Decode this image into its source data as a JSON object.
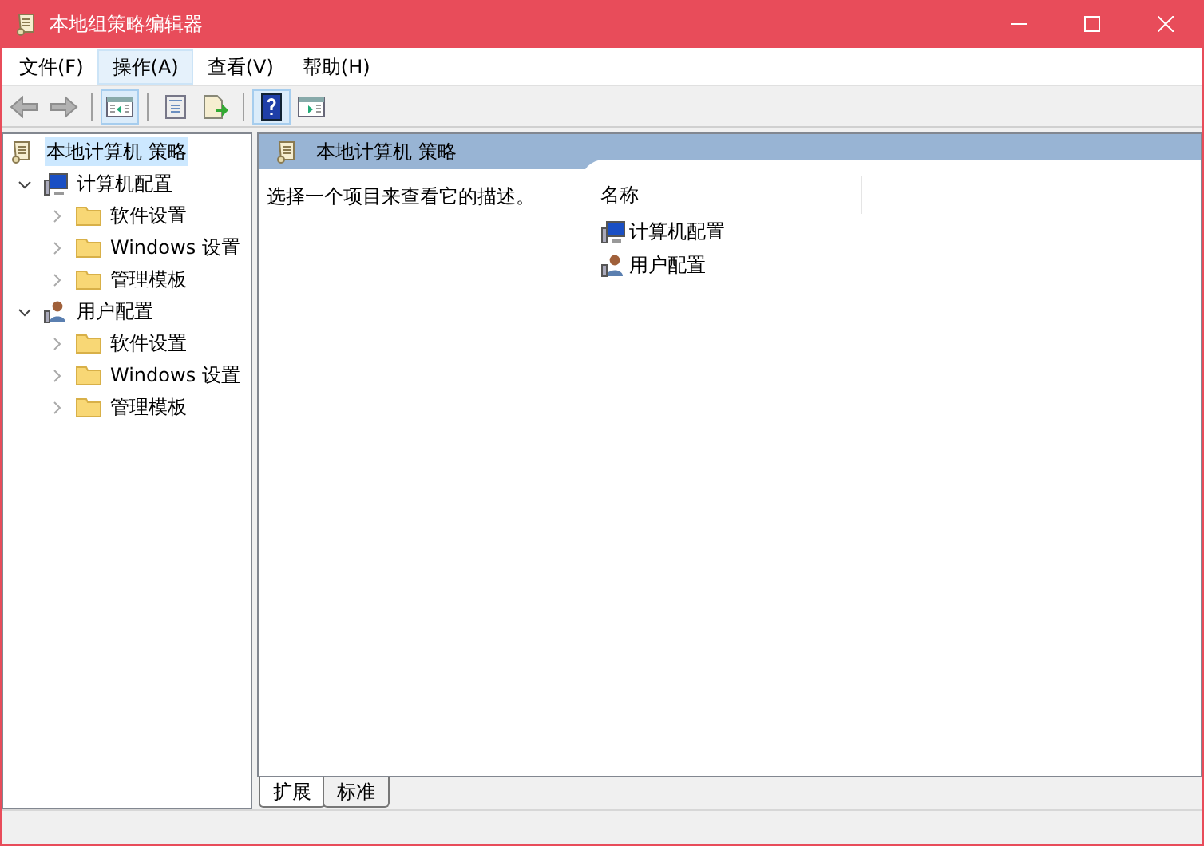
{
  "window": {
    "title": "本地组策略编辑器"
  },
  "menu": [
    {
      "label": "文件(F)",
      "selected": false
    },
    {
      "label": "操作(A)",
      "selected": true
    },
    {
      "label": "查看(V)",
      "selected": false
    },
    {
      "label": "帮助(H)",
      "selected": false
    }
  ],
  "toolbar": [
    {
      "kind": "back",
      "disabled": true,
      "pressed": false
    },
    {
      "kind": "forward",
      "disabled": true,
      "pressed": false
    },
    {
      "kind": "sep"
    },
    {
      "kind": "tree",
      "disabled": false,
      "pressed": true
    },
    {
      "kind": "sep"
    },
    {
      "kind": "properties",
      "disabled": false,
      "pressed": false
    },
    {
      "kind": "export",
      "disabled": false,
      "pressed": false
    },
    {
      "kind": "sep"
    },
    {
      "kind": "help",
      "disabled": false,
      "pressed": true
    },
    {
      "kind": "action",
      "disabled": false,
      "pressed": false
    }
  ],
  "tree": [
    {
      "label": "本地计算机 策略",
      "kind": "policy",
      "selected": true,
      "children": [
        {
          "label": "计算机配置",
          "kind": "computer",
          "selected": false,
          "expanded": true,
          "children": [
            {
              "label": "软件设置",
              "kind": "folder",
              "selected": false,
              "expanded": false
            },
            {
              "label": "Windows 设置",
              "kind": "folder",
              "selected": false,
              "expanded": false
            },
            {
              "label": "管理模板",
              "kind": "folder",
              "selected": false,
              "expanded": false
            }
          ]
        },
        {
          "label": "用户配置",
          "kind": "user",
          "selected": false,
          "expanded": true,
          "children": [
            {
              "label": "软件设置",
              "kind": "folder",
              "selected": false,
              "expanded": false
            },
            {
              "label": "Windows 设置",
              "kind": "folder",
              "selected": false,
              "expanded": false
            },
            {
              "label": "管理模板",
              "kind": "folder",
              "selected": false,
              "expanded": false
            }
          ]
        }
      ]
    }
  ],
  "pane": {
    "title": "本地计算机 策略",
    "description": "选择一个项目来查看它的描述。",
    "columns": [
      "名称"
    ],
    "items": [
      {
        "label": "计算机配置",
        "kind": "computer"
      },
      {
        "label": "用户配置",
        "kind": "user"
      }
    ]
  },
  "tabs": [
    {
      "label": "扩展",
      "selected": true
    },
    {
      "label": "标准",
      "selected": false
    }
  ]
}
